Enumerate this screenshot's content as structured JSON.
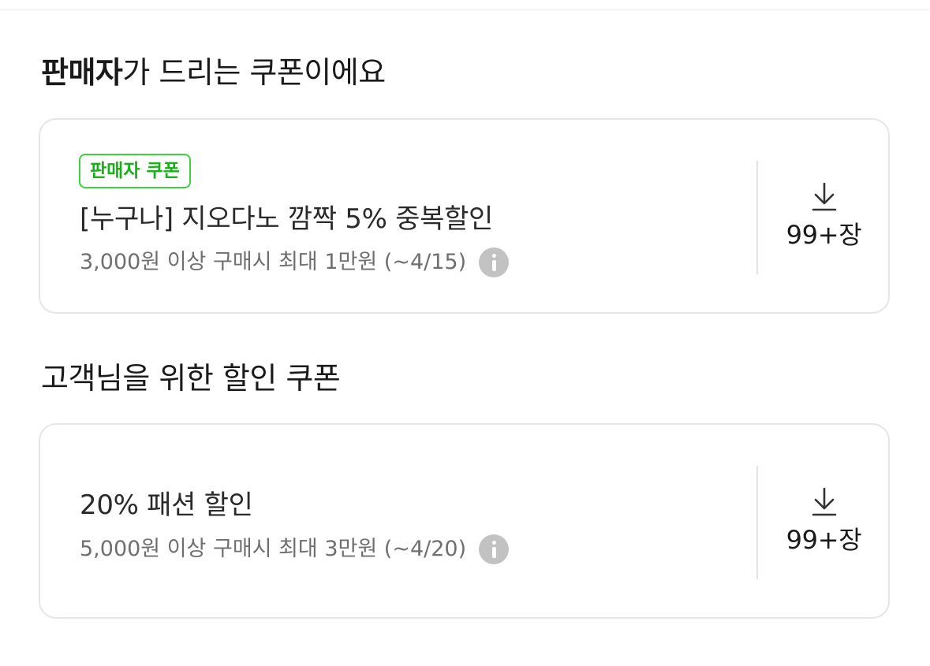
{
  "seller_section": {
    "title_bold": "판매자",
    "title_rest": "가 드리는 쿠폰이에요",
    "coupon": {
      "badge": "판매자 쿠폰",
      "name": "[누구나] 지오다노 깜짝 5% 중복할인",
      "condition": "3,000원 이상 구매시 최대 1만원 (~4/15)",
      "info_icon": "info-icon",
      "download_icon": "download-icon",
      "count": "99+장"
    }
  },
  "customer_section": {
    "title": "고객님을 위한 할인 쿠폰",
    "coupon": {
      "name": "20% 패션 할인",
      "condition": "5,000원 이상 구매시 최대 3만원 (~4/20)",
      "info_icon": "info-icon",
      "download_icon": "download-icon",
      "count": "99+장"
    }
  },
  "colors": {
    "badge_border": "#3dd13d",
    "badge_text": "#18b118",
    "card_border": "#e6e6e6",
    "secondary_text": "#6f6f6f",
    "info_icon": "#c2c2c2"
  }
}
